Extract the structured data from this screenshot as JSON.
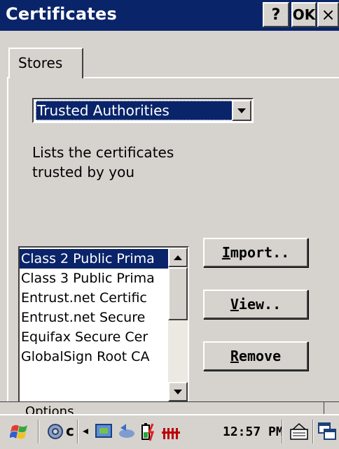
{
  "window": {
    "title": "Certificates",
    "help_label": "?",
    "ok_label": "OK",
    "close_label": "×"
  },
  "tabs": [
    {
      "label": "Stores"
    }
  ],
  "store_select": {
    "selected": "Trusted Authorities"
  },
  "description": "Lists the certificates trusted by you",
  "cert_list": {
    "items": [
      {
        "label": "Class 2 Public Prima",
        "selected": true
      },
      {
        "label": "Class 3 Public Prima",
        "selected": false
      },
      {
        "label": "Entrust.net Certific",
        "selected": false
      },
      {
        "label": "Entrust.net Secure",
        "selected": false
      },
      {
        "label": "Equifax Secure Cer",
        "selected": false
      },
      {
        "label": "GlobalSign Root CA",
        "selected": false
      }
    ]
  },
  "buttons": {
    "import": {
      "prefix": "",
      "mnemonic": "I",
      "rest": "mport.."
    },
    "view": {
      "prefix": "",
      "mnemonic": "V",
      "rest": "iew.."
    },
    "remove": {
      "prefix": "",
      "mnemonic": "R",
      "rest": "emove"
    }
  },
  "options_label": "Options",
  "taskbar": {
    "time": "12:57 PM",
    "icons": [
      "start-flag-icon",
      "settings-gear-icon",
      "network-icon",
      "sync-icon",
      "battery-icon",
      "signal-icon",
      "keyboard-icon",
      "windows-switch-icon"
    ]
  },
  "colors": {
    "title_bg": "#0a246a",
    "face": "#d6d3ce",
    "selection": "#0a246a"
  }
}
